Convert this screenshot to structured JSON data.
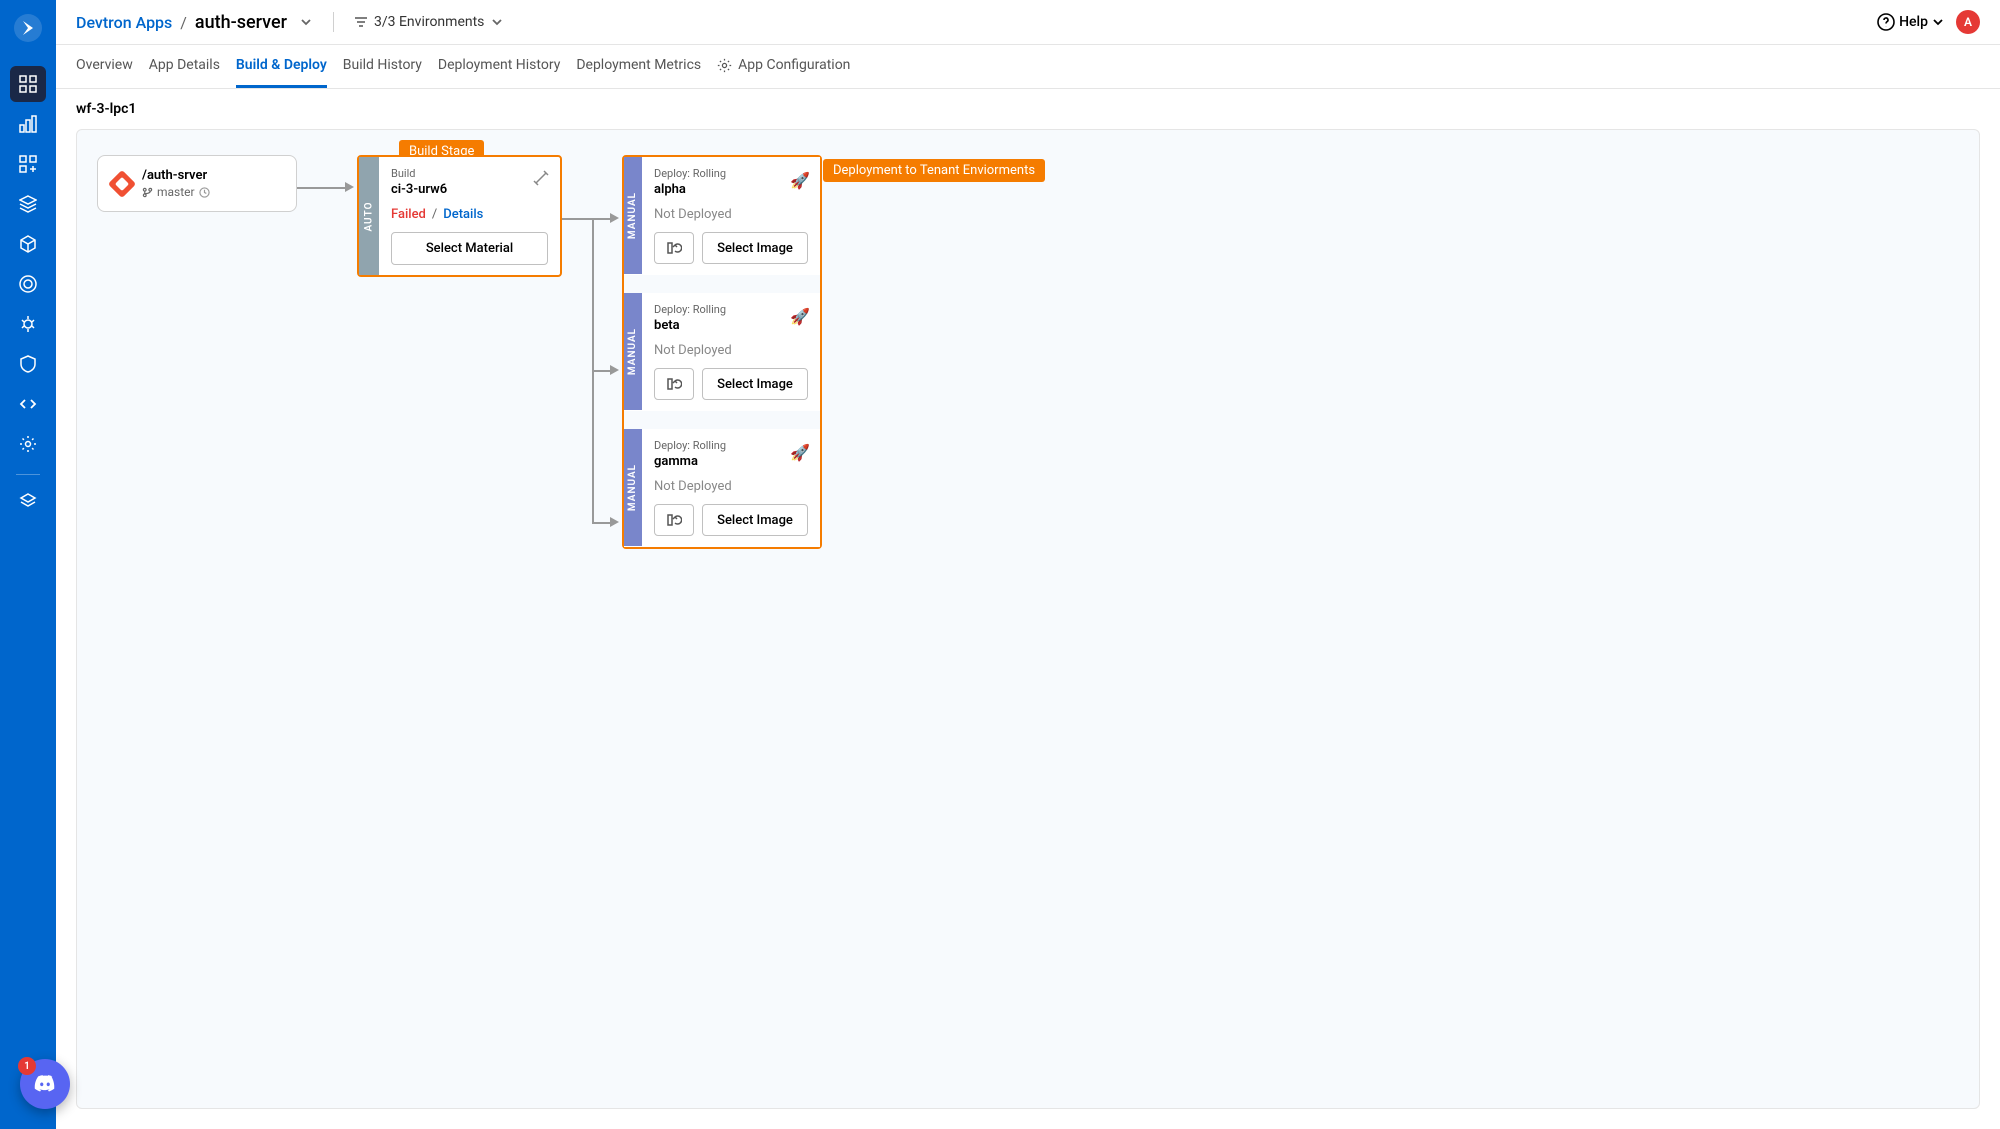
{
  "breadcrumb": {
    "root": "Devtron Apps",
    "current": "auth-server"
  },
  "envFilter": "3/3 Environments",
  "help": "Help",
  "avatar": "A",
  "tabs": [
    {
      "label": "Overview"
    },
    {
      "label": "App Details"
    },
    {
      "label": "Build & Deploy",
      "active": true
    },
    {
      "label": "Build History"
    },
    {
      "label": "Deployment History"
    },
    {
      "label": "Deployment Metrics"
    },
    {
      "label": "App Configuration",
      "icon": true
    }
  ],
  "workflowName": "wf-3-lpc1",
  "stageLabels": {
    "build": "Build Stage",
    "deploy": "Deployment to Tenant Enviorments"
  },
  "source": {
    "repo": "/auth-srver",
    "branch": "master"
  },
  "ci": {
    "mode": "AUTO",
    "label": "Build",
    "name": "ci-3-urw6",
    "status": "Failed",
    "statusSep": "/",
    "detailsLink": "Details",
    "button": "Select Material"
  },
  "cd": {
    "mode": "MANUAL",
    "deployLabel": "Deploy: Rolling",
    "notDeployed": "Not Deployed",
    "selectImage": "Select Image",
    "envs": [
      {
        "name": "alpha"
      },
      {
        "name": "beta"
      },
      {
        "name": "gamma"
      }
    ]
  },
  "fab": {
    "badge": "1"
  }
}
